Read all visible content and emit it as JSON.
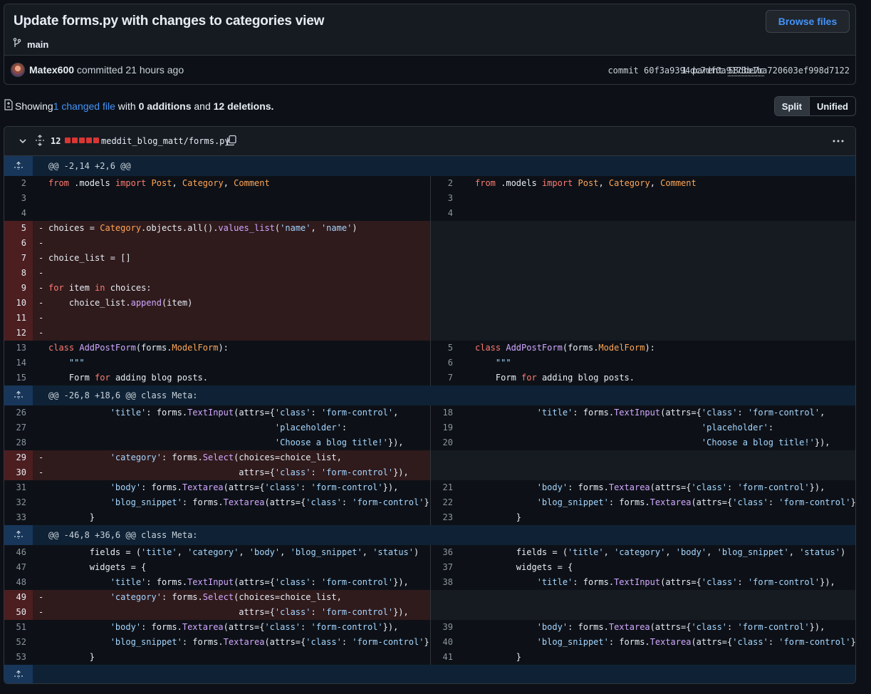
{
  "commit": {
    "title": "Update forms.py with changes to categories view",
    "branch": "main",
    "browse_label": "Browse files",
    "author": "Matex600",
    "committed_text": " committed 21 hours ago",
    "parent_prefix": "1 parent ",
    "parent_sha": "58dbe7c",
    "commit_prefix": "commit ",
    "commit_sha": "60f3a9394dc7df0a9173b1ba720603ef998d7122"
  },
  "summary": {
    "prefix": "Showing ",
    "changed": "1 changed file",
    "with": " with ",
    "additions": "0 additions",
    "and": " and ",
    "deletions": "12 deletions",
    "period": "."
  },
  "view_toggle": {
    "split": "Split",
    "unified": "Unified"
  },
  "file": {
    "change_count": "12",
    "path": "meddit_blog_matt/forms.py",
    "icons": {
      "collapse": "chevron-down-icon",
      "expand": "unfold-icon",
      "copy": "copy-icon",
      "menu": "kebab-icon"
    }
  },
  "colors": {
    "deletion_bg": "#2f1a1c",
    "hunk_bg": "#0f2235",
    "link": "#4493f8"
  },
  "diff_rows": [
    {
      "t": "hunk",
      "text": "@@ -2,14 +2,6 @@"
    },
    {
      "t": "ctx",
      "ln": "2",
      "rn": "2",
      "code": "from .models import Post, Category, Comment"
    },
    {
      "t": "ctx",
      "ln": "3",
      "rn": "3",
      "code": ""
    },
    {
      "t": "ctx",
      "ln": "4",
      "rn": "4",
      "code": ""
    },
    {
      "t": "del",
      "ln": "5",
      "code": "choices = Category.objects.all().values_list('name', 'name')"
    },
    {
      "t": "del",
      "ln": "6",
      "code": ""
    },
    {
      "t": "del",
      "ln": "7",
      "code": "choice_list = []"
    },
    {
      "t": "del",
      "ln": "8",
      "code": ""
    },
    {
      "t": "del",
      "ln": "9",
      "code": "for item in choices:"
    },
    {
      "t": "del",
      "ln": "10",
      "code": "    choice_list.append(item)"
    },
    {
      "t": "del",
      "ln": "11",
      "code": ""
    },
    {
      "t": "del",
      "ln": "12",
      "code": ""
    },
    {
      "t": "ctx",
      "ln": "13",
      "rn": "5",
      "code": "class AddPostForm(forms.ModelForm):"
    },
    {
      "t": "ctx",
      "ln": "14",
      "rn": "6",
      "code": "    \"\"\""
    },
    {
      "t": "ctx",
      "ln": "15",
      "rn": "7",
      "code": "    Form for adding blog posts."
    },
    {
      "t": "hunk",
      "text": "@@ -26,8 +18,6 @@ class Meta:"
    },
    {
      "t": "ctx",
      "ln": "26",
      "rn": "18",
      "code": "            'title': forms.TextInput(attrs={'class': 'form-control',"
    },
    {
      "t": "ctx",
      "ln": "27",
      "rn": "19",
      "code": "                                            'placeholder':"
    },
    {
      "t": "ctx",
      "ln": "28",
      "rn": "20",
      "code": "                                            'Choose a blog title!'}),"
    },
    {
      "t": "del",
      "ln": "29",
      "code": "            'category': forms.Select(choices=choice_list,"
    },
    {
      "t": "del",
      "ln": "30",
      "code": "                                     attrs={'class': 'form-control'}),"
    },
    {
      "t": "ctx",
      "ln": "31",
      "rn": "21",
      "code": "            'body': forms.Textarea(attrs={'class': 'form-control'}),"
    },
    {
      "t": "ctx",
      "ln": "32",
      "rn": "22",
      "code": "            'blog_snippet': forms.Textarea(attrs={'class': 'form-control'}),"
    },
    {
      "t": "ctx",
      "ln": "33",
      "rn": "23",
      "code": "        }"
    },
    {
      "t": "hunk",
      "text": "@@ -46,8 +36,6 @@ class Meta:"
    },
    {
      "t": "ctx",
      "ln": "46",
      "rn": "36",
      "code": "        fields = ('title', 'category', 'body', 'blog_snippet', 'status')"
    },
    {
      "t": "ctx",
      "ln": "47",
      "rn": "37",
      "code": "        widgets = {"
    },
    {
      "t": "ctx",
      "ln": "48",
      "rn": "38",
      "code": "            'title': forms.TextInput(attrs={'class': 'form-control'}),"
    },
    {
      "t": "del",
      "ln": "49",
      "code": "            'category': forms.Select(choices=choice_list,"
    },
    {
      "t": "del",
      "ln": "50",
      "code": "                                     attrs={'class': 'form-control'}),"
    },
    {
      "t": "ctx",
      "ln": "51",
      "rn": "39",
      "code": "            'body': forms.Textarea(attrs={'class': 'form-control'}),"
    },
    {
      "t": "ctx",
      "ln": "52",
      "rn": "40",
      "code": "            'blog_snippet': forms.Textarea(attrs={'class': 'form-control'}),"
    },
    {
      "t": "ctx",
      "ln": "53",
      "rn": "41",
      "code": "        }"
    },
    {
      "t": "hunk",
      "text": ""
    }
  ]
}
